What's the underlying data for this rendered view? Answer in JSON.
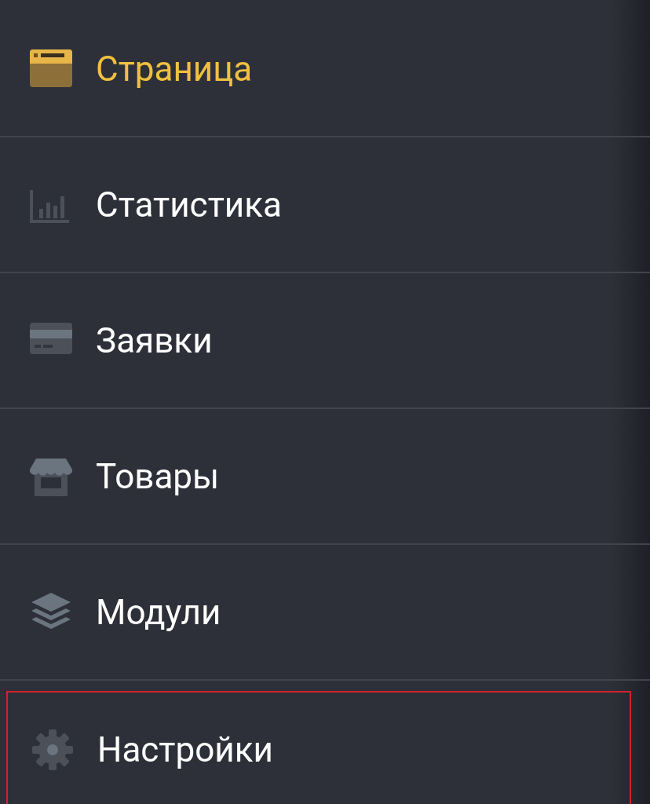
{
  "menu": {
    "items": [
      {
        "label": "Страница",
        "kind": "page",
        "selected": true,
        "outlined": false
      },
      {
        "label": "Статистика",
        "kind": "chart",
        "selected": false,
        "outlined": false
      },
      {
        "label": "Заявки",
        "kind": "card",
        "selected": false,
        "outlined": false
      },
      {
        "label": "Товары",
        "kind": "store",
        "selected": false,
        "outlined": false
      },
      {
        "label": "Модули",
        "kind": "layers",
        "selected": false,
        "outlined": false
      },
      {
        "label": "Настройки",
        "kind": "gear",
        "selected": false,
        "outlined": true
      }
    ]
  }
}
